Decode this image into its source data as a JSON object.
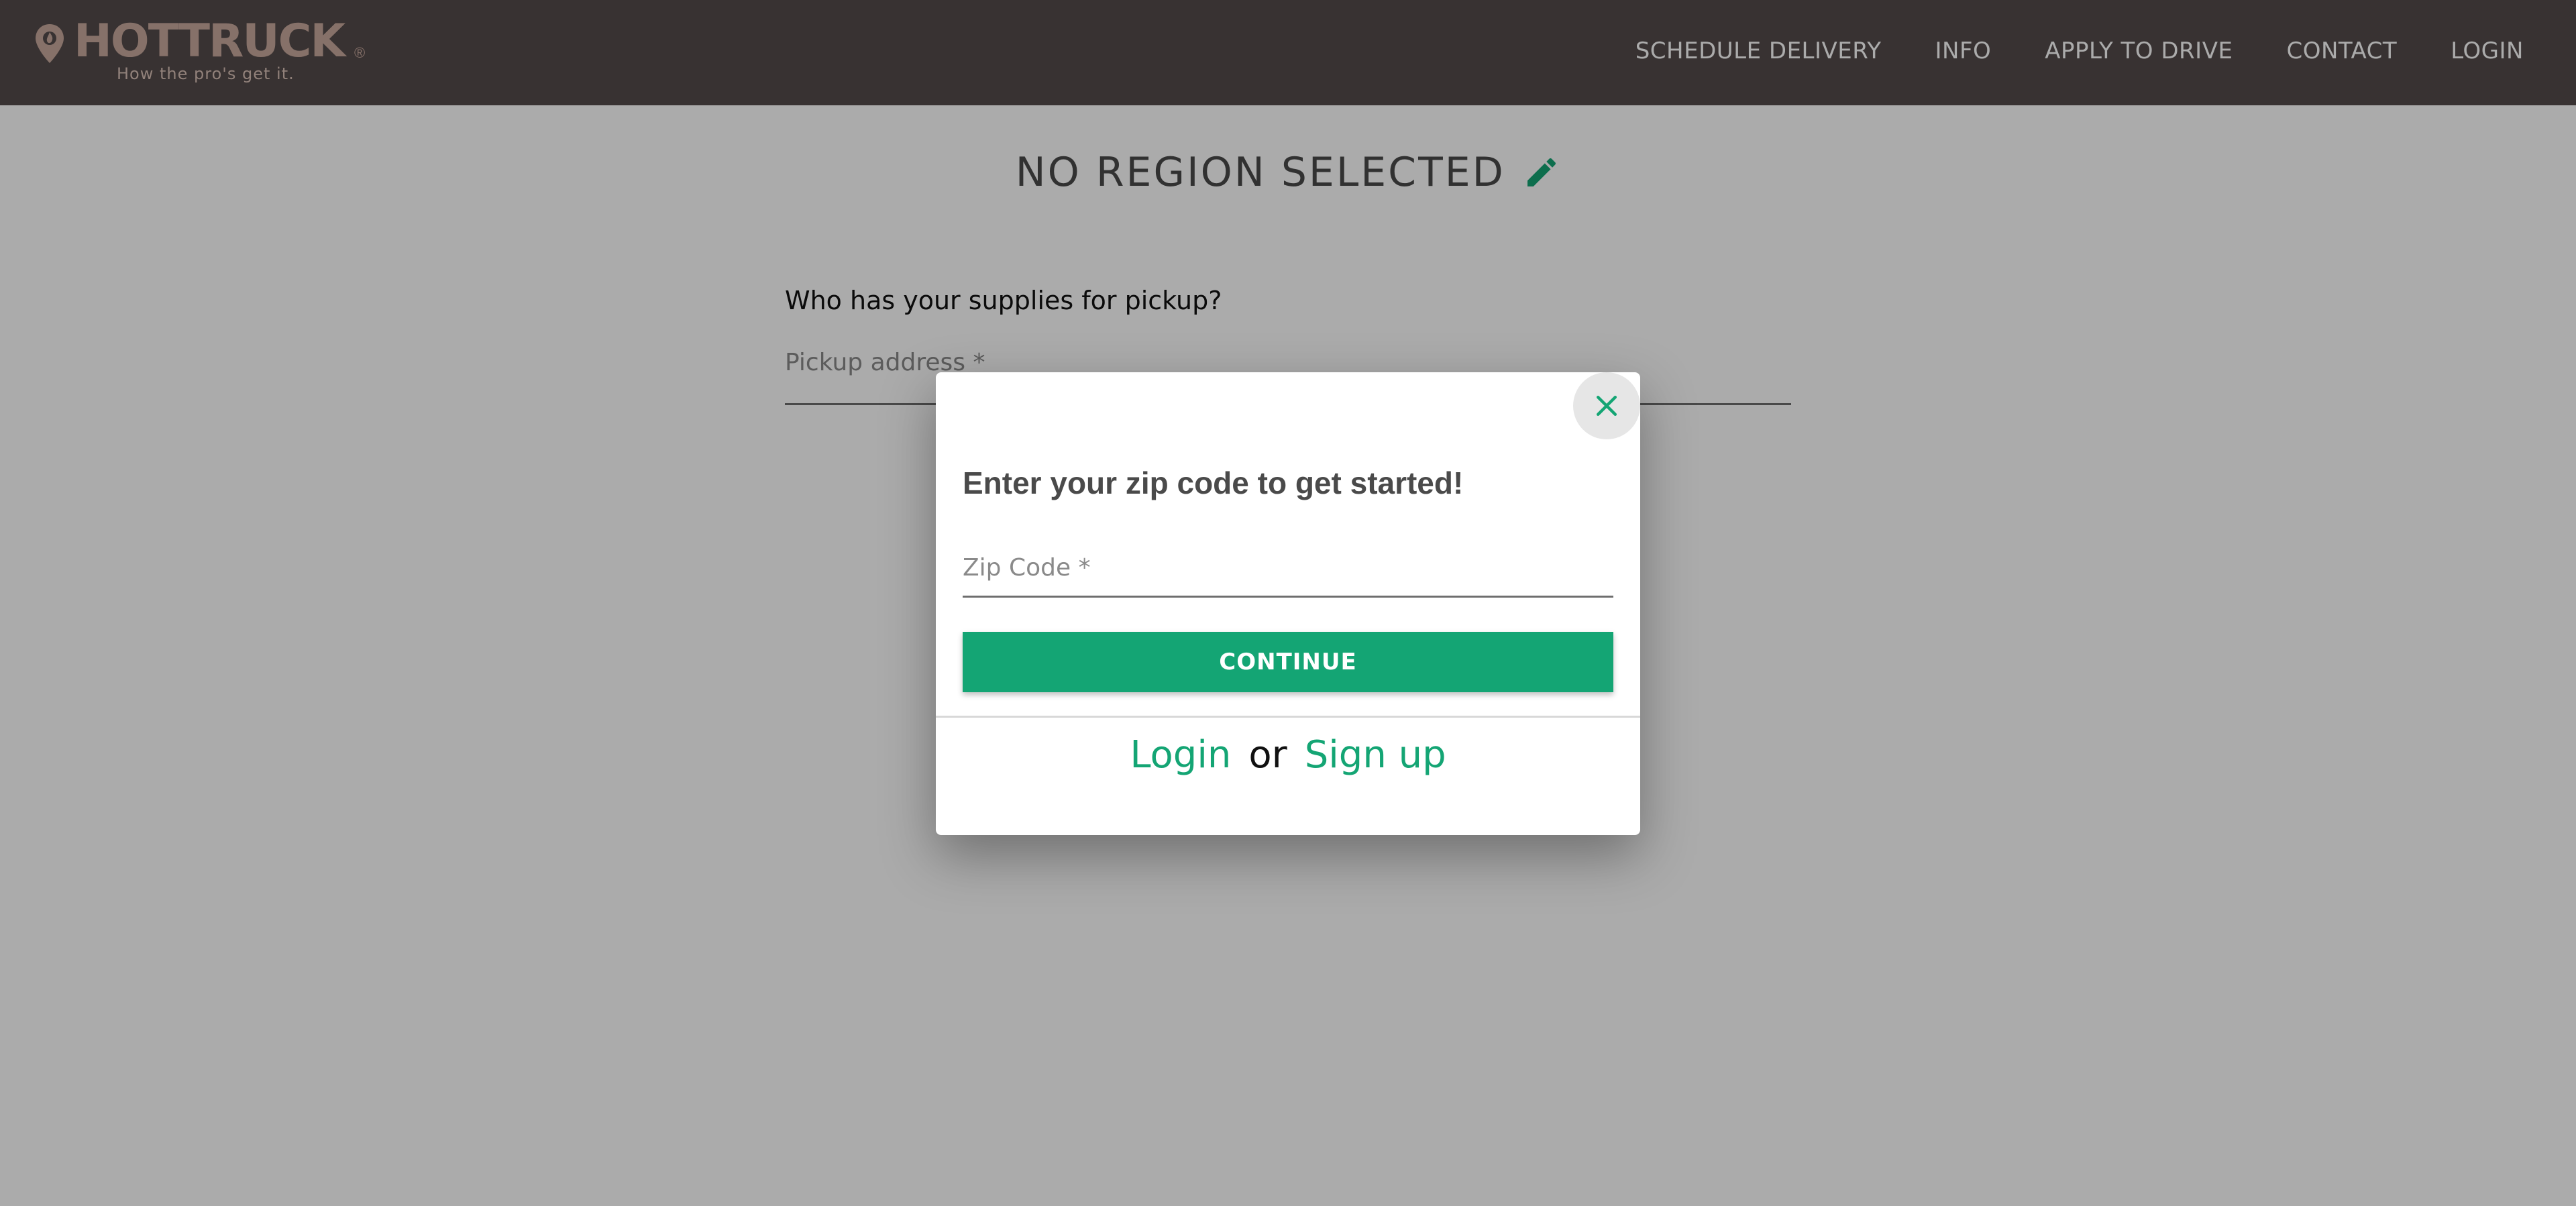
{
  "header": {
    "logo_text": "HOTTRUCK",
    "logo_registered": "®",
    "logo_tagline": "How the pro's get it.",
    "nav": [
      {
        "label": "SCHEDULE DELIVERY"
      },
      {
        "label": "INFO"
      },
      {
        "label": "APPLY TO DRIVE"
      },
      {
        "label": "CONTACT"
      },
      {
        "label": "LOGIN"
      }
    ]
  },
  "main": {
    "region_title": "NO REGION SELECTED",
    "pickup_question": "Who has your supplies for pickup?",
    "pickup_field_label": "Pickup address *"
  },
  "modal": {
    "heading": "Enter your zip code to get started!",
    "zip_placeholder": "Zip Code *",
    "continue_label": "CONTINUE",
    "login_label": "Login",
    "or_label": "or",
    "signup_label": "Sign up"
  },
  "icons": {
    "logo": "location-pin-icon",
    "edit": "pencil-icon",
    "close": "close-icon"
  },
  "colors": {
    "header_bg": "#544b4b",
    "accent_green": "#14a574",
    "logo_copper": "#c8a99d",
    "overlay": "rgba(0,0,0,0.33)"
  }
}
